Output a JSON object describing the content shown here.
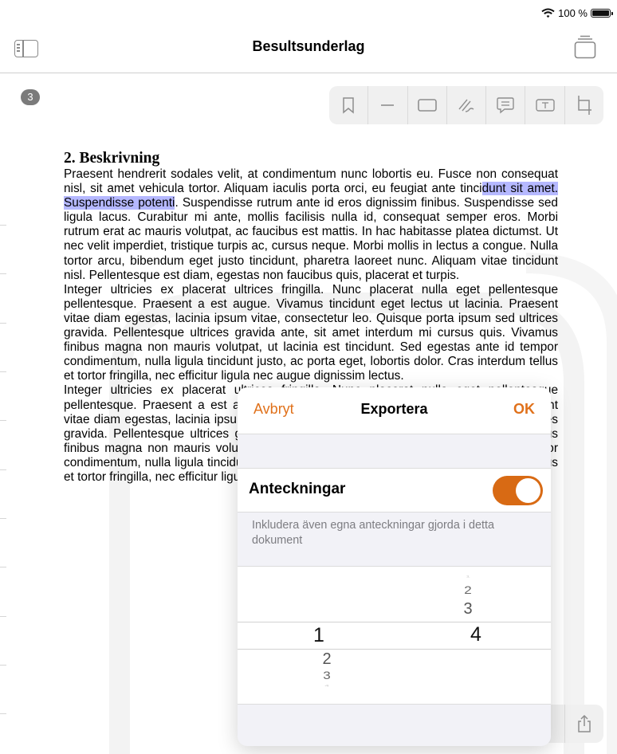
{
  "status_bar": {
    "battery_label": "100 %"
  },
  "nav": {
    "title": "Besultsunderlag",
    "icons": {
      "sidebar": "sidebar-icon",
      "documents": "document-stack-icon"
    }
  },
  "page_badge": "3",
  "toolbar": {
    "tools": [
      "bookmark-icon",
      "line-icon",
      "rectangle-icon",
      "signature-icon",
      "comment-icon",
      "text-box-icon",
      "crop-icon"
    ]
  },
  "document": {
    "heading": "2. Beskrivning",
    "para1_before": "Praesent hendrerit sodales velit, at condimentum nunc lobortis eu. Fusce non consequat nisl, sit amet vehicula tortor. Aliquam iaculis porta orci, eu feugiat ante tinci",
    "para1_highlight": "dunt sit amet. Suspendisse potenti",
    "para1_after": ". Suspendisse rutrum ante id eros dignissim finibus. Suspendisse sed ligula lacus. Curabitur mi ante, mollis facilisis nulla id, consequat semper eros. Morbi rutrum erat ac mauris volutpat, ac faucibus est mattis. In hac habitasse platea dictumst. Ut nec velit imperdiet, tristique turpis ac, cursus neque. Morbi mollis in lectus a congue. Nulla tortor arcu, bibendum eget justo tincidunt, pharetra laoreet nunc. Aliquam vitae tincidunt nisl. Pellentesque est diam, egestas non faucibus quis, placerat et turpis.",
    "para2": "Integer ultricies ex placerat ultrices fringilla. Nunc placerat nulla eget pellentesque pellentesque. Praesent a est augue. Vivamus tincidunt eget lectus ut lacinia. Praesent vitae diam egestas, lacinia ipsum vitae, consectetur leo. Quisque porta ipsum sed ultrices gravida. Pellentesque ultrices gravida ante, sit amet interdum mi cursus quis. Vivamus finibus magna non mauris volutpat, ut lacinia est tincidunt. Sed egestas ante id tempor condimentum, nulla ligula tincidunt justo, ac porta eget, lobortis dolor. Cras interdum tellus et tortor fringilla, nec efficitur ligula nec augue dignissim lectus.",
    "para3": "Integer ultricies ex placerat ultrices fringilla. Nunc placerat nulla eget pellentesque pellentesque. Praesent a est augue. Vivamus tincidunt eget lectus ut lacinia. Praesent vitae diam egestas, lacinia ipsum vitae, consectetur leo. Quisque porta ipsum sed ultrices gravida. Pellentesque ultrices gravida ante, sit amet interdum mi cursus quis. Vivamus finibus magna non mauris volutpat, ut lacinia est tincidunt. Sed egestas ante id tempor condimentum, nulla ligula tincidunt justo, ac porta eget, lobortis dolor. Cras interdum tellus et tortor fringilla, nec efficitur ligula nec augue dignissim lectus."
  },
  "export_dialog": {
    "cancel_label": "Avbryt",
    "title": "Exportera",
    "ok_label": "OK",
    "option_label": "Anteckningar",
    "option_enabled": true,
    "option_description": "Inkludera även egna anteckningar gjorda i detta dokument",
    "picker": {
      "left_selected": "1",
      "left_after": [
        "2",
        "3"
      ],
      "right_before": [
        "2",
        "3"
      ],
      "right_selected": "4"
    }
  },
  "share_icon": "share-icon",
  "colors": {
    "accent": "#e0711b",
    "toggle_on": "#d86a14",
    "highlight": "#b5b8ff"
  }
}
